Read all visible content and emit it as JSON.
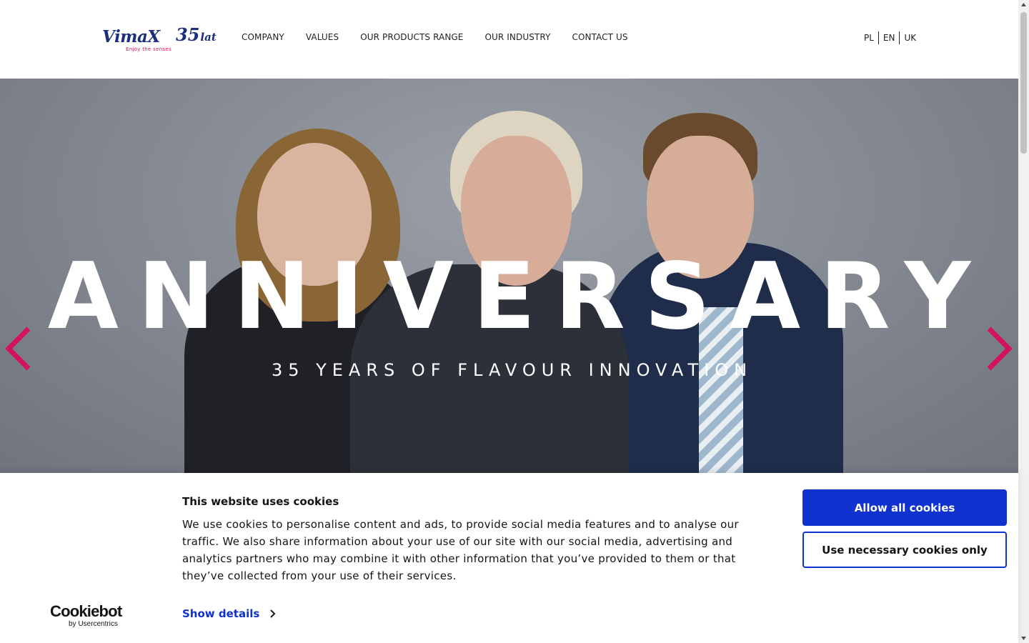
{
  "logo": {
    "brand": "VimaX",
    "anniversary_number": "35",
    "anniversary_word": "lat",
    "tagline": "Enjoy the senses"
  },
  "nav": {
    "items": [
      "COMPANY",
      "VALUES",
      "OUR PRODUCTS RANGE",
      "OUR INDUSTRY",
      "CONTACT US"
    ]
  },
  "languages": [
    "PL",
    "EN",
    "UK"
  ],
  "hero": {
    "title": "ANNIVERSARY",
    "subtitle": "35 YEARS OF FLAVOUR INNOVATION",
    "prev_icon": "chevron-left-icon",
    "next_icon": "chevron-right-icon",
    "arrow_color": "#d4145a"
  },
  "cookie_banner": {
    "provider_logo": "Cookiebot",
    "provider_sub": "by Usercentrics",
    "title": "This website uses cookies",
    "body": "We use cookies to personalise content and ads, to provide social media features and to analyse our traffic. We also share information about your use of our site with our social media, advertising and analytics partners who may combine it with other information that you’ve provided to them or that they’ve collected from your use of their services.",
    "show_details": "Show details",
    "allow_all": "Allow all cookies",
    "necessary_only": "Use necessary cookies only",
    "accent_color": "#1032cf"
  },
  "colors": {
    "brand_blue": "#1b2f7c",
    "brand_pink": "#d4145a"
  }
}
